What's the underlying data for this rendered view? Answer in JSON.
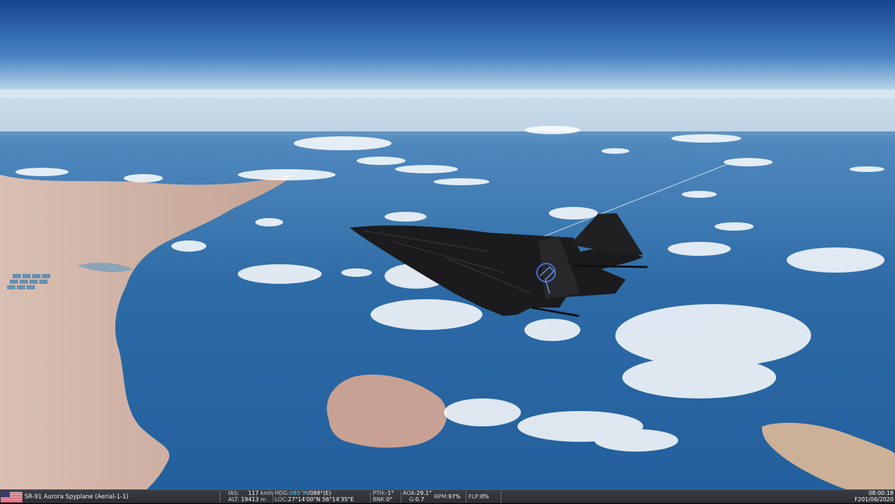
{
  "aircraft": {
    "name": "SR-91 Aurora Spyplane (Aerial-1-1)",
    "flag_icon": "us-flag-icon"
  },
  "hud": {
    "ias_label": "IAS:",
    "ias_value": "117",
    "ias_unit": "kmh",
    "alt_label": "ALT:",
    "alt_value": "19413",
    "alt_unit": "m",
    "hdg_label": "HDG:",
    "hdg_value_magnetic": "085°M",
    "hdg_value_true": "/088°(E)",
    "loc_label": "LOC:",
    "loc_value": "27°14'00\"N 56°14'35\"E",
    "pth_label": "PTH:",
    "pth_value": "-1°",
    "bnk_label": "BNK:",
    "bnk_value": "0°",
    "aoa_label": "AOA:",
    "aoa_value": "29.1°",
    "g_label": "G:",
    "g_value": "0.7",
    "rpm_label": "RPM:",
    "rpm_value": "97%",
    "flp_label": "FLP:",
    "flp_value": "0%"
  },
  "clock": {
    "time": "08:00:18",
    "date": "F201/06/2020"
  },
  "aircraft_emblem_icon": "eagle-roundel-icon",
  "colors": {
    "sky_top": "#1a4f9a",
    "ocean": "#2a6aa8",
    "land": "#c9a99a",
    "aircraft": "#1b1b1d",
    "hud_highlight": "#5fd3ff"
  }
}
